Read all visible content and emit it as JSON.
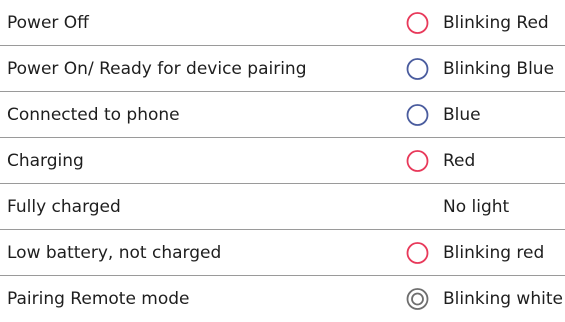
{
  "rows": [
    {
      "status": "Power Off",
      "icon": "red-circle-icon",
      "color": "#e8395a",
      "light": "Blinking Red"
    },
    {
      "status": "Power On/ Ready for device pairing",
      "icon": "blue-circle-icon",
      "color": "#4a5c9e",
      "light": "Blinking Blue"
    },
    {
      "status": "Connected to phone",
      "icon": "blue-circle-icon",
      "color": "#4a5c9e",
      "light": "Blue"
    },
    {
      "status": "Charging",
      "icon": "red-circle-icon",
      "color": "#e8395a",
      "light": "Red"
    },
    {
      "status": "Fully charged",
      "icon": "",
      "color": "",
      "light": "No light"
    },
    {
      "status": "Low battery, not charged",
      "icon": "red-circle-icon",
      "color": "#e8395a",
      "light": "Blinking red"
    },
    {
      "status": "Pairing Remote mode",
      "icon": "white-double-circle-icon",
      "color": "#6e6e6e",
      "light": "Blinking white"
    }
  ]
}
